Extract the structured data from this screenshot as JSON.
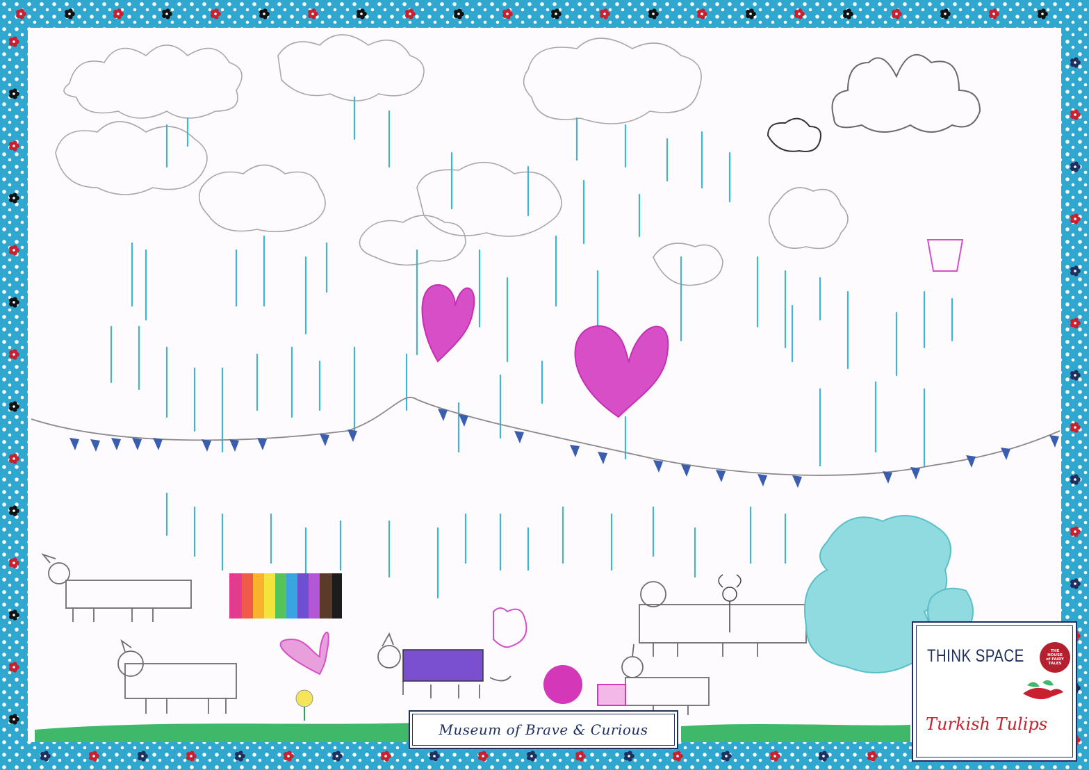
{
  "drawing": {
    "colors": {
      "border": "#2fa7cf",
      "rain": "#3fb6cf",
      "pencil": "#9a9a9a",
      "heart": "#d233b8",
      "grass": "#2aa85a",
      "brand_navy": "#1f2f5e",
      "brand_red": "#c8202e"
    },
    "icons": [
      "cloud-icon",
      "heart-icon",
      "rainbow-icon",
      "unicorn-icon",
      "flower-icon",
      "bunting-icon"
    ]
  },
  "labels": {
    "museum": "Museum of Brave & Curious",
    "brand_title": "THINK SPACE",
    "brand_subtitle": "Turkish Tulips",
    "logo_text": "THE\nHOUSE\nof FAIRY\nTALES"
  }
}
